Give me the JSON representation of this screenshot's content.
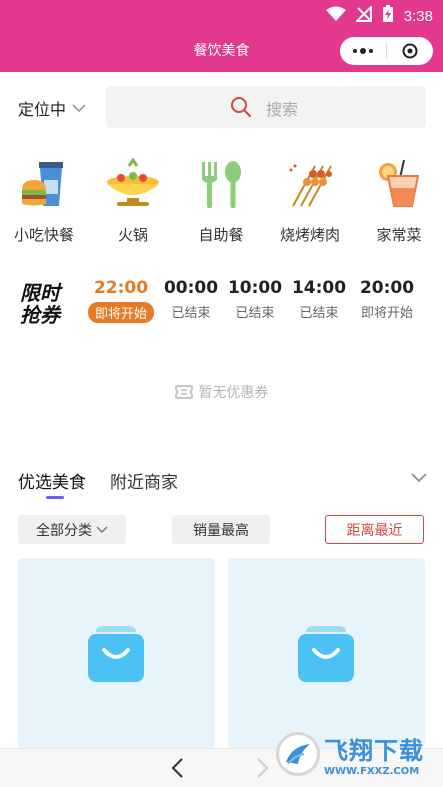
{
  "status_bar": {
    "time": "3:38"
  },
  "header": {
    "title": "餐饮美食"
  },
  "location": {
    "label": "定位中"
  },
  "search": {
    "placeholder": "搜索"
  },
  "categories": [
    {
      "label": "小吃快餐",
      "icon": "burger-drink-icon"
    },
    {
      "label": "火锅",
      "icon": "hotpot-icon"
    },
    {
      "label": "自助餐",
      "icon": "fork-spoon-icon"
    },
    {
      "label": "烧烤烤肉",
      "icon": "skewers-icon"
    },
    {
      "label": "家常菜",
      "icon": "cocktail-icon"
    }
  ],
  "flash_sale": {
    "badge_line1": "限时",
    "badge_line2": "抢券",
    "slots": [
      {
        "time": "22:00",
        "status": "即将开始",
        "active": true
      },
      {
        "time": "00:00",
        "status": "已结束"
      },
      {
        "time": "10:00",
        "status": "已结束"
      },
      {
        "time": "14:00",
        "status": "已结束"
      },
      {
        "time": "20:00",
        "status": "即将开始"
      }
    ]
  },
  "empty_coupon": {
    "text": "暂无优惠券"
  },
  "tabs": [
    {
      "label": "优选美食",
      "active": true
    },
    {
      "label": "附近商家",
      "active": false
    }
  ],
  "filters": {
    "all": "全部分类",
    "sales": "销量最高",
    "distance": "距离最近"
  },
  "watermark": {
    "title": "飞翔下载",
    "url": "WWW.FXXZ.COM"
  },
  "colors": {
    "brand": "#e2398f",
    "accent_orange": "#e57b26",
    "tab_underline": "#6b5cff",
    "filter_red": "#d04848",
    "card_bg": "#e8f4fb",
    "placeholder_icon": "#4cc1f5"
  }
}
